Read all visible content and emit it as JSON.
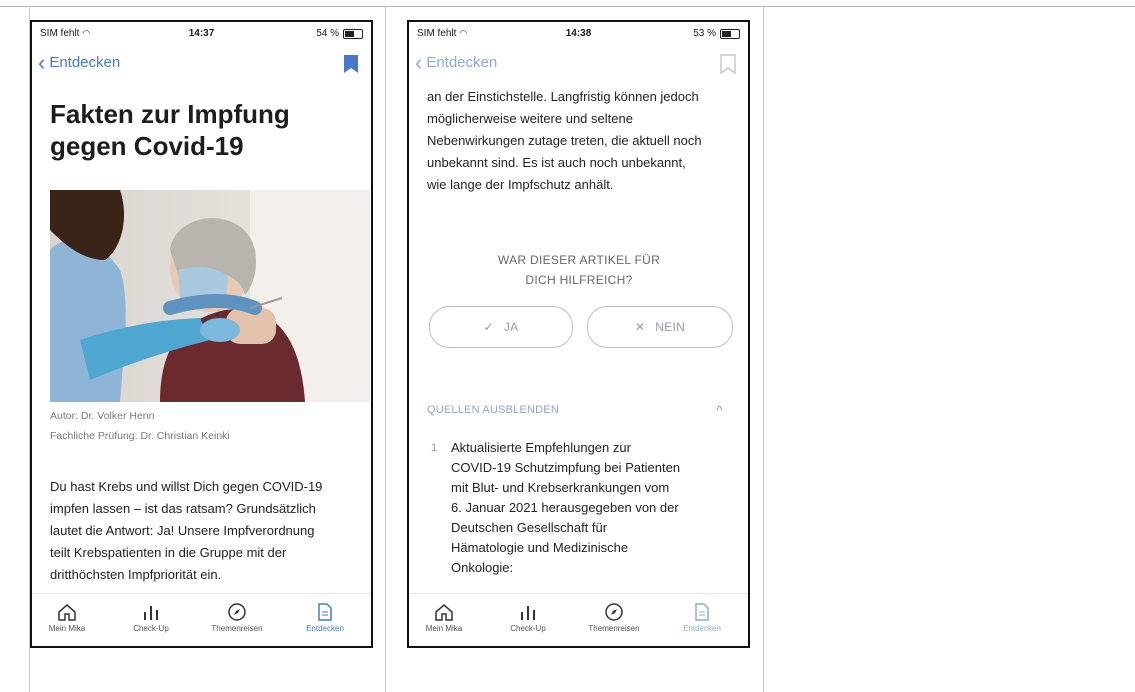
{
  "screen1": {
    "status": {
      "carrier": "SIM fehlt",
      "time": "14:37",
      "battery": "54 %"
    },
    "nav": {
      "back_label": "Entdecken"
    },
    "title": "Fakten zur Impfung gegen Covid-19",
    "author": "Autor: Dr. Volker Henn",
    "reviewer": "Fachliche Prüfung: Dr. Christian Keinki",
    "body": [
      "Du hast Krebs und willst Dich gegen COVID-19",
      "impfen lassen – ist das ratsam? Grundsätzlich",
      "lautet die Antwort: Ja! Unsere Impfverordnung",
      "teilt Krebspatienten in die Gruppe mit der",
      "dritthöchsten Impfpriorität ein."
    ]
  },
  "screen2": {
    "status": {
      "carrier": "SIM fehlt",
      "time": "14:38",
      "battery": "53 %"
    },
    "nav": {
      "back_label": "Entdecken"
    },
    "body": [
      "an der Einstichstelle. Langfristig können jedoch",
      "möglicherweise weitere und seltene",
      "Nebenwirkungen zutage treten, die aktuell noch",
      "unbekannt sind. Es ist auch noch unbekannt,",
      "wie lange der Impfschutz anhält."
    ],
    "feedback": {
      "question_line1": "WAR DIESER ARTIKEL FÜR",
      "question_line2": "DICH HILFREICH?",
      "yes_label": "JA",
      "no_label": "NEIN"
    },
    "sources": {
      "toggle_label": "QUELLEN AUSBLENDEN",
      "item_number": "1",
      "item_lines": [
        "Aktualisierte Empfehlungen zur",
        "COVID-19 Schutzimpfung bei Patienten",
        "mit Blut- und Krebserkrankungen vom",
        "6. Januar 2021 herausgegeben von der",
        "Deutschen Gesellschaft für",
        "Hämatologie und Medizinische",
        "Onkologie:"
      ]
    }
  },
  "tabbar": [
    {
      "label": "Mein Mika",
      "icon": "home-icon"
    },
    {
      "label": "Check-Up",
      "icon": "bar-chart-icon"
    },
    {
      "label": "Themenreisen",
      "icon": "compass-icon"
    },
    {
      "label": "Entdecken",
      "icon": "document-icon"
    }
  ],
  "colors": {
    "accent": "#4a78c8",
    "text": "#1d1d1d",
    "muted": "#7a7a7a"
  }
}
